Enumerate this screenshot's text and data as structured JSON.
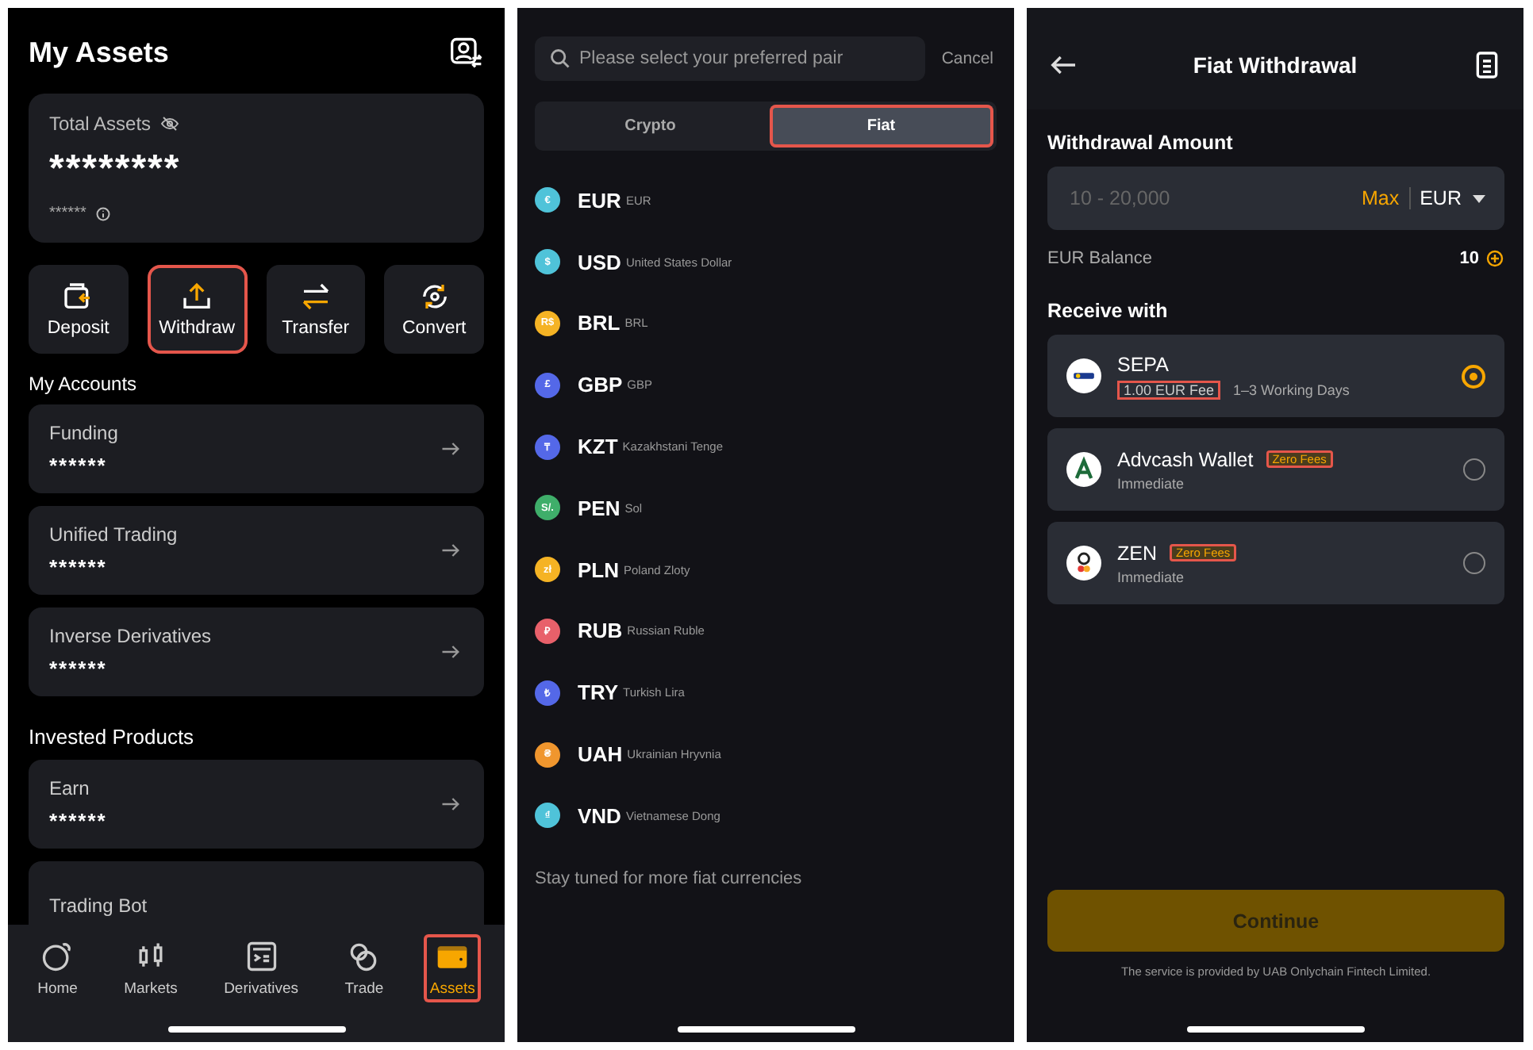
{
  "assets_screen": {
    "title": "My Assets",
    "total_card": {
      "label": "Total Assets",
      "value": "********",
      "sub_value": "******"
    },
    "actions": [
      {
        "kind": "deposit",
        "label": "Deposit",
        "highlighted": false
      },
      {
        "kind": "withdraw",
        "label": "Withdraw",
        "highlighted": true
      },
      {
        "kind": "transfer",
        "label": "Transfer",
        "highlighted": false
      },
      {
        "kind": "convert",
        "label": "Convert",
        "highlighted": false
      }
    ],
    "accounts_heading": "My Accounts",
    "accounts": [
      {
        "name": "Funding",
        "value": "******"
      },
      {
        "name": "Unified Trading",
        "value": "******"
      },
      {
        "name": "Inverse Derivatives",
        "value": "******"
      }
    ],
    "products_heading": "Invested Products",
    "products": [
      {
        "name": "Earn",
        "value": "******"
      },
      {
        "name": "Trading Bot"
      }
    ],
    "nav": [
      {
        "kind": "home",
        "label": "Home",
        "selected": false,
        "highlighted": false
      },
      {
        "kind": "markets",
        "label": "Markets",
        "selected": false,
        "highlighted": false
      },
      {
        "kind": "derivatives",
        "label": "Derivatives",
        "selected": false,
        "highlighted": false
      },
      {
        "kind": "trade",
        "label": "Trade",
        "selected": false,
        "highlighted": false
      },
      {
        "kind": "assets",
        "label": "Assets",
        "selected": true,
        "highlighted": true
      }
    ]
  },
  "currency_picker": {
    "search": {
      "placeholder": "Please select your preferred pair"
    },
    "cancel": "Cancel",
    "tabs": [
      {
        "label": "Crypto",
        "selected": false,
        "highlighted": false
      },
      {
        "label": "Fiat",
        "selected": true,
        "highlighted": true
      }
    ],
    "currencies": [
      {
        "symbol": "€",
        "code": "EUR",
        "name": "EUR",
        "color": "#4fc3d9"
      },
      {
        "symbol": "$",
        "code": "USD",
        "name": "United States Dollar",
        "color": "#4fc3d9"
      },
      {
        "symbol": "R$",
        "code": "BRL",
        "name": "BRL",
        "color": "#f5b324"
      },
      {
        "symbol": "£",
        "code": "GBP",
        "name": "GBP",
        "color": "#5468e8"
      },
      {
        "symbol": "₸",
        "code": "KZT",
        "name": "Kazakhstani Tenge",
        "color": "#5468e8"
      },
      {
        "symbol": "S/.",
        "code": "PEN",
        "name": "Sol",
        "color": "#3fae6a"
      },
      {
        "symbol": "zł",
        "code": "PLN",
        "name": "Poland Zloty",
        "color": "#f5b324"
      },
      {
        "symbol": "₽",
        "code": "RUB",
        "name": "Russian Ruble",
        "color": "#e8606a"
      },
      {
        "symbol": "₺",
        "code": "TRY",
        "name": "Turkish Lira",
        "color": "#5468e8"
      },
      {
        "symbol": "₴",
        "code": "UAH",
        "name": "Ukrainian Hryvnia",
        "color": "#f0962e"
      },
      {
        "symbol": "₫",
        "code": "VND",
        "name": "Vietnamese Dong",
        "color": "#4fc3d9"
      }
    ],
    "footer_note": "Stay tuned for more fiat currencies"
  },
  "fiat_withdrawal": {
    "title": "Fiat Withdrawal",
    "amount_heading": "Withdrawal Amount",
    "amount_field": {
      "placeholder": "10 - 20,000",
      "max": "Max",
      "currency": "EUR"
    },
    "balance_label": "EUR Balance",
    "balance_value": "10",
    "receive_heading": "Receive with",
    "methods": [
      {
        "kind": "sepa",
        "name": "SEPA",
        "fee": "1.00 EUR Fee",
        "fee_highlighted": true,
        "detail": "1–3 Working Days",
        "selected": true
      },
      {
        "kind": "advcash",
        "name": "Advcash Wallet",
        "badge": "Zero Fees",
        "badge_highlighted": true,
        "detail": "Immediate",
        "selected": false
      },
      {
        "kind": "zen",
        "name": "ZEN",
        "badge": "Zero Fees",
        "badge_highlighted": true,
        "detail": "Immediate",
        "selected": false
      }
    ],
    "continue_button": "Continue",
    "disclaimer": "The service is provided by UAB Onlychain Fintech Limited."
  }
}
